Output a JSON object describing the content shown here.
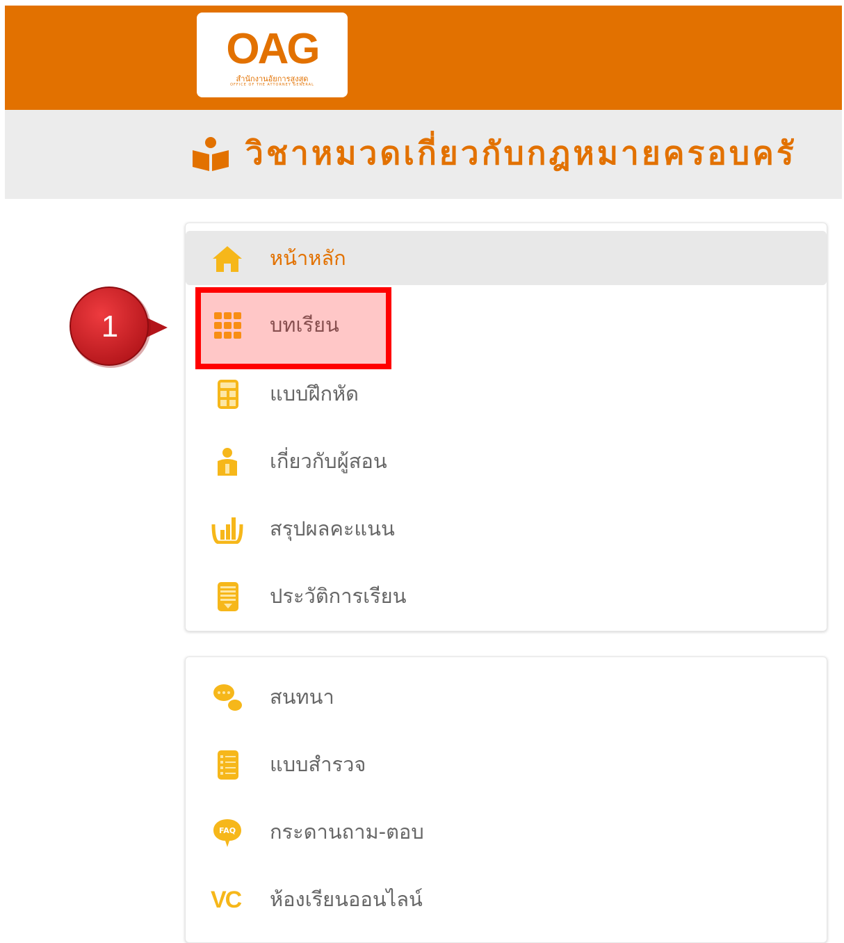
{
  "header": {
    "logo_text": "OAG",
    "logo_sub_th": "สำนักงานอัยการสูงสุด",
    "logo_sub_en": "OFFICE OF THE ATTORNEY GENERAL",
    "bg_color": "#e27100"
  },
  "course": {
    "title": "วิชาหมวดเกี่ยวกับกฎหมายครอบครั",
    "icon": "reading-person-icon"
  },
  "menu_primary": [
    {
      "label": "หน้าหลัก",
      "icon": "home-icon",
      "active": true
    },
    {
      "label": "บทเรียน",
      "icon": "grid-icon",
      "active": false
    },
    {
      "label": "แบบฝึกหัด",
      "icon": "calculator-icon",
      "active": false
    },
    {
      "label": "เกี่ยวกับผู้สอน",
      "icon": "instructor-icon",
      "active": false
    },
    {
      "label": "สรุปผลคะแนน",
      "icon": "bar-chart-icon",
      "active": false
    },
    {
      "label": "ประวัติการเรียน",
      "icon": "history-icon",
      "active": false
    }
  ],
  "menu_secondary": [
    {
      "label": "สนทนา",
      "icon": "chat-icon"
    },
    {
      "label": "แบบสำรวจ",
      "icon": "survey-icon"
    },
    {
      "label": "กระดานถาม-ตอบ",
      "icon": "faq-icon"
    },
    {
      "label": "ห้องเรียนออนไลน์",
      "icon": "vc-icon",
      "icon_text": "VC"
    }
  ],
  "annotation": {
    "step_number": "1",
    "highlight_color": "#ff0000",
    "marker_color": "#c8181e"
  },
  "colors": {
    "accent": "#e27100",
    "icon_yellow": "#f6b71a",
    "text_gray": "#666666"
  }
}
